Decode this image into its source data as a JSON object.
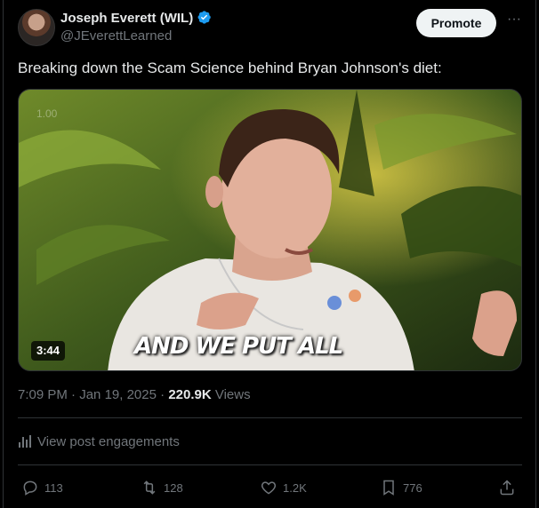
{
  "author": {
    "name": "Joseph Everett (WIL)",
    "handle": "@JEverettLearned",
    "verified": true
  },
  "header": {
    "promote_label": "Promote",
    "more_icon": "more-icon"
  },
  "tweet": {
    "text": "Breaking down the Scam Science behind Bryan Johnson's diet:"
  },
  "media": {
    "speed_label": "1.00",
    "caption": "AND WE PUT ALL",
    "duration": "3:44"
  },
  "meta": {
    "time": "7:09 PM",
    "date": "Jan 19, 2025",
    "views_count": "220.9K",
    "views_label": "Views",
    "separator": "·"
  },
  "engagements": {
    "label": "View post engagements",
    "icon": "analytics-icon"
  },
  "actions": {
    "replies": "113",
    "reposts": "128",
    "likes": "1.2K",
    "bookmarks": "776"
  },
  "colors": {
    "background": "#000000",
    "text_primary": "#e7e9ea",
    "text_secondary": "#71767b",
    "verified_blue": "#1d9bf0",
    "promote_bg": "#eff3f4"
  }
}
